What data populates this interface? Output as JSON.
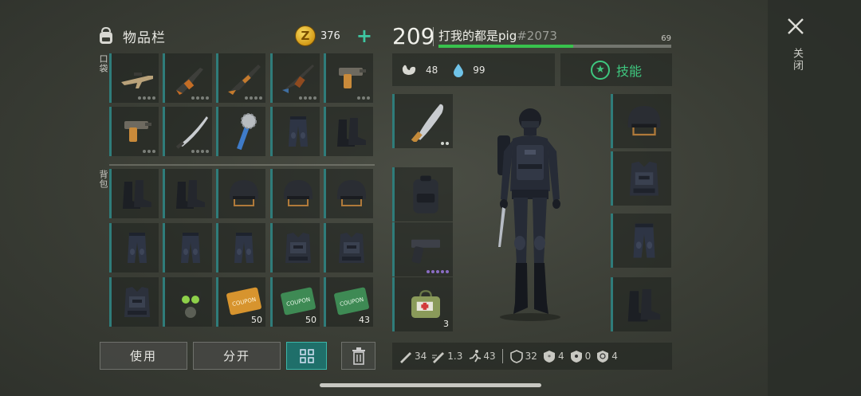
{
  "inventory": {
    "title": "物品栏",
    "currency": {
      "symbol": "Z",
      "amount": "376",
      "add": "+"
    },
    "pocket_label": "口袋",
    "backpack_label": "背包",
    "pocket_items": [
      {
        "icon": "assault-rifle-icon",
        "count": "",
        "dots": 4
      },
      {
        "icon": "rifle-icon",
        "count": "",
        "dots": 4
      },
      {
        "icon": "shotgun-icon",
        "count": "",
        "dots": 4
      },
      {
        "icon": "ak-rifle-icon",
        "count": "",
        "dots": 4
      },
      {
        "icon": "pistol-orange-icon",
        "count": "",
        "dots": 3
      },
      {
        "icon": "pistol-orange-icon",
        "count": "",
        "dots": 3
      },
      {
        "icon": "katana-icon",
        "count": "",
        "dots": 4
      },
      {
        "icon": "saw-mace-icon",
        "count": "",
        "dots": 0
      },
      {
        "icon": "pants-icon",
        "count": "",
        "dots": 0
      },
      {
        "icon": "boots-icon",
        "count": "",
        "dots": 0
      }
    ],
    "backpack_items": [
      {
        "icon": "boots-icon",
        "count": ""
      },
      {
        "icon": "boots-icon",
        "count": ""
      },
      {
        "icon": "helmet-icon",
        "count": ""
      },
      {
        "icon": "helmet-icon",
        "count": ""
      },
      {
        "icon": "helmet-icon",
        "count": ""
      },
      {
        "icon": "pants-icon",
        "count": ""
      },
      {
        "icon": "pants-icon",
        "count": ""
      },
      {
        "icon": "pants-icon",
        "count": ""
      },
      {
        "icon": "vest-icon",
        "count": ""
      },
      {
        "icon": "vest-icon",
        "count": ""
      },
      {
        "icon": "vest-icon",
        "count": ""
      },
      {
        "icon": "gas-mask-icon",
        "count": ""
      },
      {
        "icon": "coupon-gold-icon",
        "count": "50"
      },
      {
        "icon": "coupon-green-icon",
        "count": "50"
      },
      {
        "icon": "coupon-green-icon",
        "count": "43"
      }
    ],
    "buttons": {
      "use": "使用",
      "split": "分开"
    }
  },
  "player": {
    "level": "209",
    "name": "打我的都是pig",
    "tag": "#2073",
    "xp_value": "69",
    "xp_fraction": 0.58,
    "hunger": "48",
    "thirst": "99",
    "skills_label": "技能",
    "star": "★"
  },
  "equipment": {
    "left": [
      {
        "icon": "machete-icon",
        "count": "",
        "dots": "2"
      },
      {
        "icon": "backpack-icon",
        "count": "",
        "dots": ""
      },
      {
        "icon": "glock-icon",
        "count": "",
        "dots": "5"
      },
      {
        "icon": "medkit-icon",
        "count": "3",
        "dots": ""
      }
    ],
    "right": [
      {
        "icon": "helmet-icon"
      },
      {
        "icon": "vest-icon"
      },
      {
        "icon": "pants-icon"
      },
      {
        "icon": "boots-icon"
      }
    ]
  },
  "stats": [
    {
      "icon": "melee-damage-icon",
      "value": "34"
    },
    {
      "icon": "attack-speed-icon",
      "value": "1.3"
    },
    {
      "icon": "move-speed-icon",
      "value": "43"
    },
    {
      "icon": "armor-icon",
      "value": "32"
    },
    {
      "icon": "cold-resist-icon",
      "value": "4"
    },
    {
      "icon": "radiation-resist-icon",
      "value": "0"
    },
    {
      "icon": "bio-resist-icon",
      "value": "4"
    }
  ],
  "close_label": "关闭",
  "colors": {
    "accent": "#2f7c7a",
    "xp": "#38c24d",
    "skill": "#3ec77f",
    "selected": "#1f6f6a"
  }
}
